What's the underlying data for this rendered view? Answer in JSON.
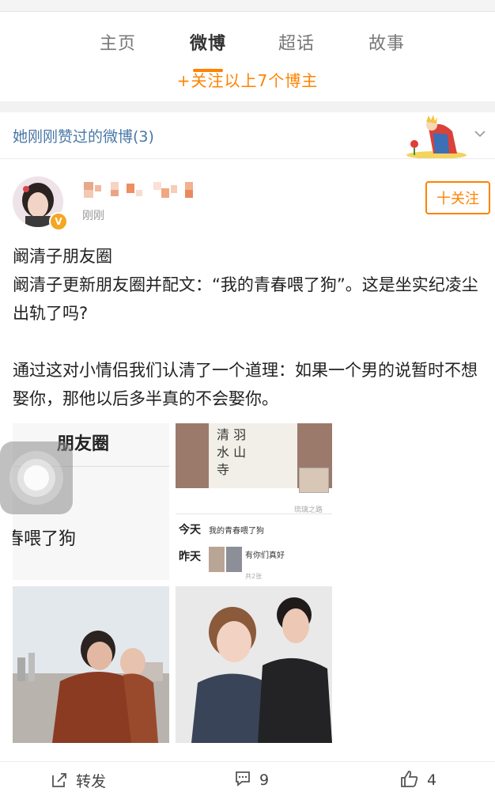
{
  "tabs": [
    {
      "label": "主页",
      "active": false
    },
    {
      "label": "微博",
      "active": true
    },
    {
      "label": "超话",
      "active": false
    },
    {
      "label": "故事",
      "active": false
    }
  ],
  "follow_link": "+关注以上7个博主",
  "liked_section": {
    "title": "她刚刚赞过的微博(3)"
  },
  "post": {
    "time": "刚刚",
    "verified_badge": "V",
    "follow_button": "十关注",
    "paragraphs": [
      "阚清子朋友圈",
      "阚清子更新朋友圈并配文：“我的青春喂了狗”。这是坐实纪凌尘出轨了吗?",
      "",
      "通过这对小情侣我们认清了一个道理：如果一个男的说暂时不想娶你，那他以后多半真的不会娶你。"
    ],
    "images": {
      "img1": {
        "title": "朋友圈",
        "text": "春喂了狗"
      },
      "img2": {
        "calligraphy": "清 羽\n水 山\n寺",
        "source": "琉璃之路",
        "today_label": "今天",
        "today_text": "我的青春喂了狗",
        "yesterday_label": "昨天",
        "yesterday_text": "有你们真好",
        "count": "共2张"
      }
    }
  },
  "actions": {
    "repost": "转发",
    "comments": "9",
    "likes": "4"
  },
  "colors": {
    "accent": "#ff8200",
    "link": "#4a78a6"
  }
}
